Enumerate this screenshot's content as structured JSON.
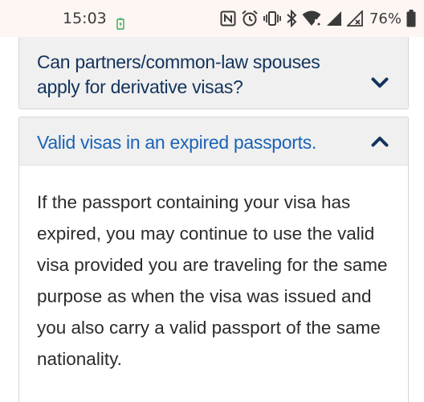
{
  "status_bar": {
    "time": "15:03",
    "battery_percent": "76%",
    "icons": [
      "nfc-icon",
      "alarm-icon",
      "vibrate-icon",
      "bluetooth-icon",
      "wifi-icon",
      "signal-icon",
      "signal-no-data-icon",
      "battery-icon"
    ]
  },
  "faq": {
    "items": [
      {
        "question": "Can partners/common-law spouses apply for derivative visas?",
        "expanded": false
      },
      {
        "question": "Valid visas in an expired passports.",
        "expanded": true,
        "answer": "If the passport containing your visa has expired, you may continue to use the valid visa provided you are traveling for the same purpose as when the visa was issued and you also carry a valid passport of the same nationality."
      }
    ]
  },
  "colors": {
    "title_collapsed": "#12335c",
    "title_expanded": "#1a63b6",
    "chevron": "#12335c",
    "header_bg": "#f0f0f0",
    "body_text": "#2b2b2b"
  }
}
